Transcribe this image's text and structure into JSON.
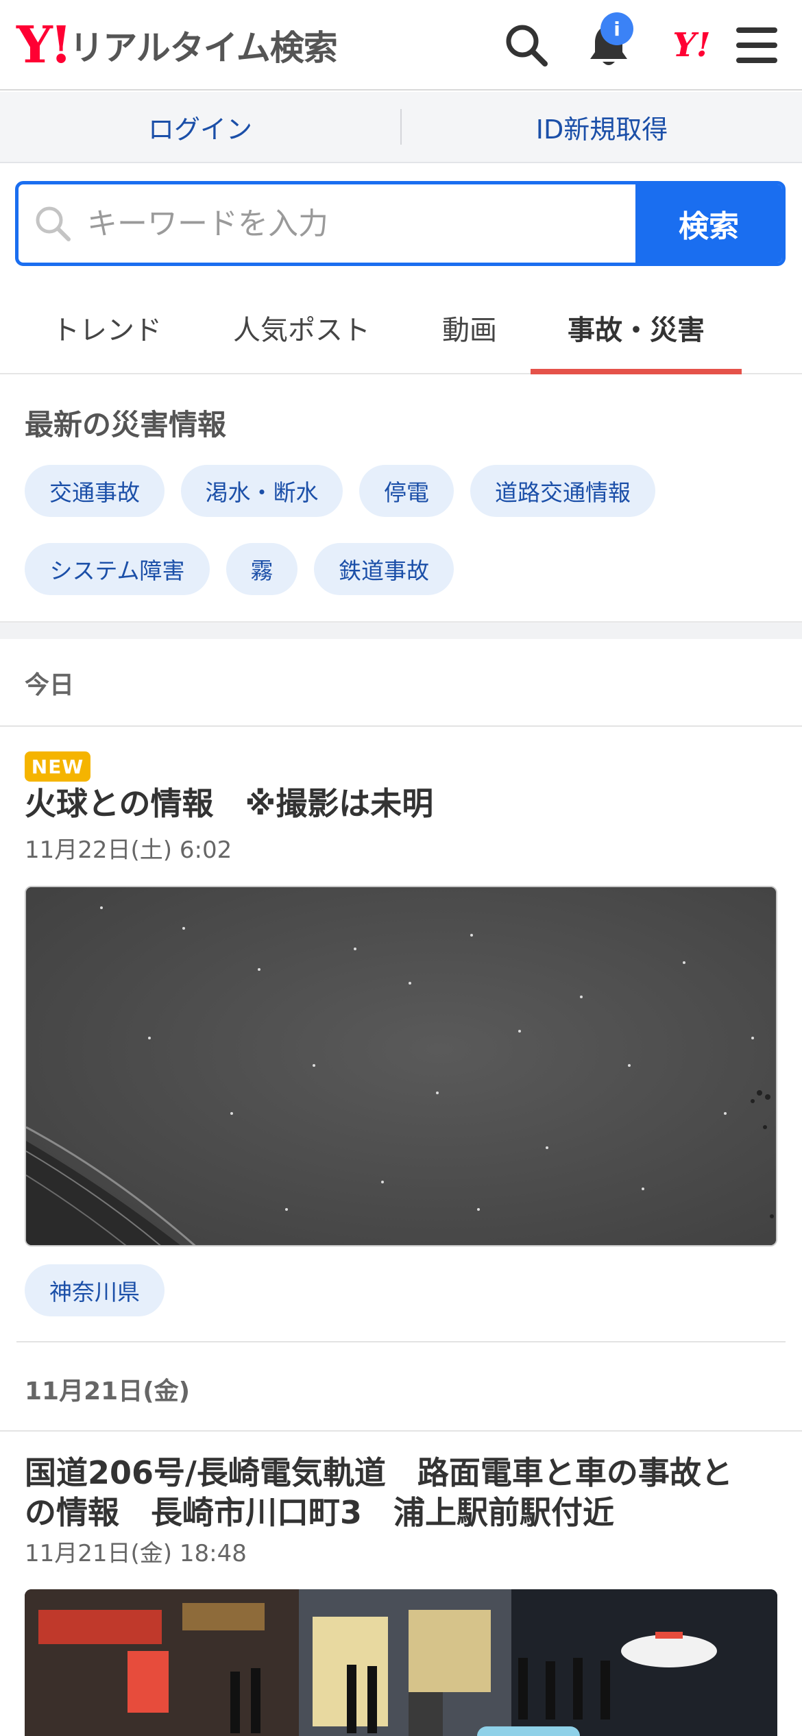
{
  "header": {
    "logo_mark": "Y!",
    "logo_text": "リアルタイム検索",
    "notification_badge": "i",
    "yahoo_mark": "Y!"
  },
  "loginbar": {
    "login": "ログイン",
    "register": "ID新規取得"
  },
  "search": {
    "placeholder": "キーワードを入力",
    "button": "検索"
  },
  "tabs": [
    {
      "label": "トレンド",
      "active": false
    },
    {
      "label": "人気ポスト",
      "active": false
    },
    {
      "label": "動画",
      "active": false
    },
    {
      "label": "事故・災害",
      "active": true
    }
  ],
  "disaster": {
    "title": "最新の災害情報",
    "chips": [
      "交通事故",
      "渇水・断水",
      "停電",
      "道路交通情報",
      "システム障害",
      "霧",
      "鉄道事故"
    ]
  },
  "feed": {
    "today_label": "今日",
    "post1": {
      "badge": "NEW",
      "title": "火球との情報　※撮影は未明",
      "date": "11月22日(土) 6:02",
      "tag": "神奈川県"
    },
    "day2_label": "11月21日(金)",
    "post2": {
      "title_line1": "国道206号/長崎電気軌道　路面電車と車の事故と",
      "title_line2": "の情報　長崎市川口町3　浦上駅前駅付近",
      "date": "11月21日(金) 18:48"
    }
  },
  "colors": {
    "brand_red": "#ff0033",
    "accent_blue": "#1a6ef0",
    "link_blue": "#1b4fa8",
    "active_tab_underline": "#e5524a",
    "chip_bg": "#e6effb",
    "new_badge": "#f5b400"
  }
}
